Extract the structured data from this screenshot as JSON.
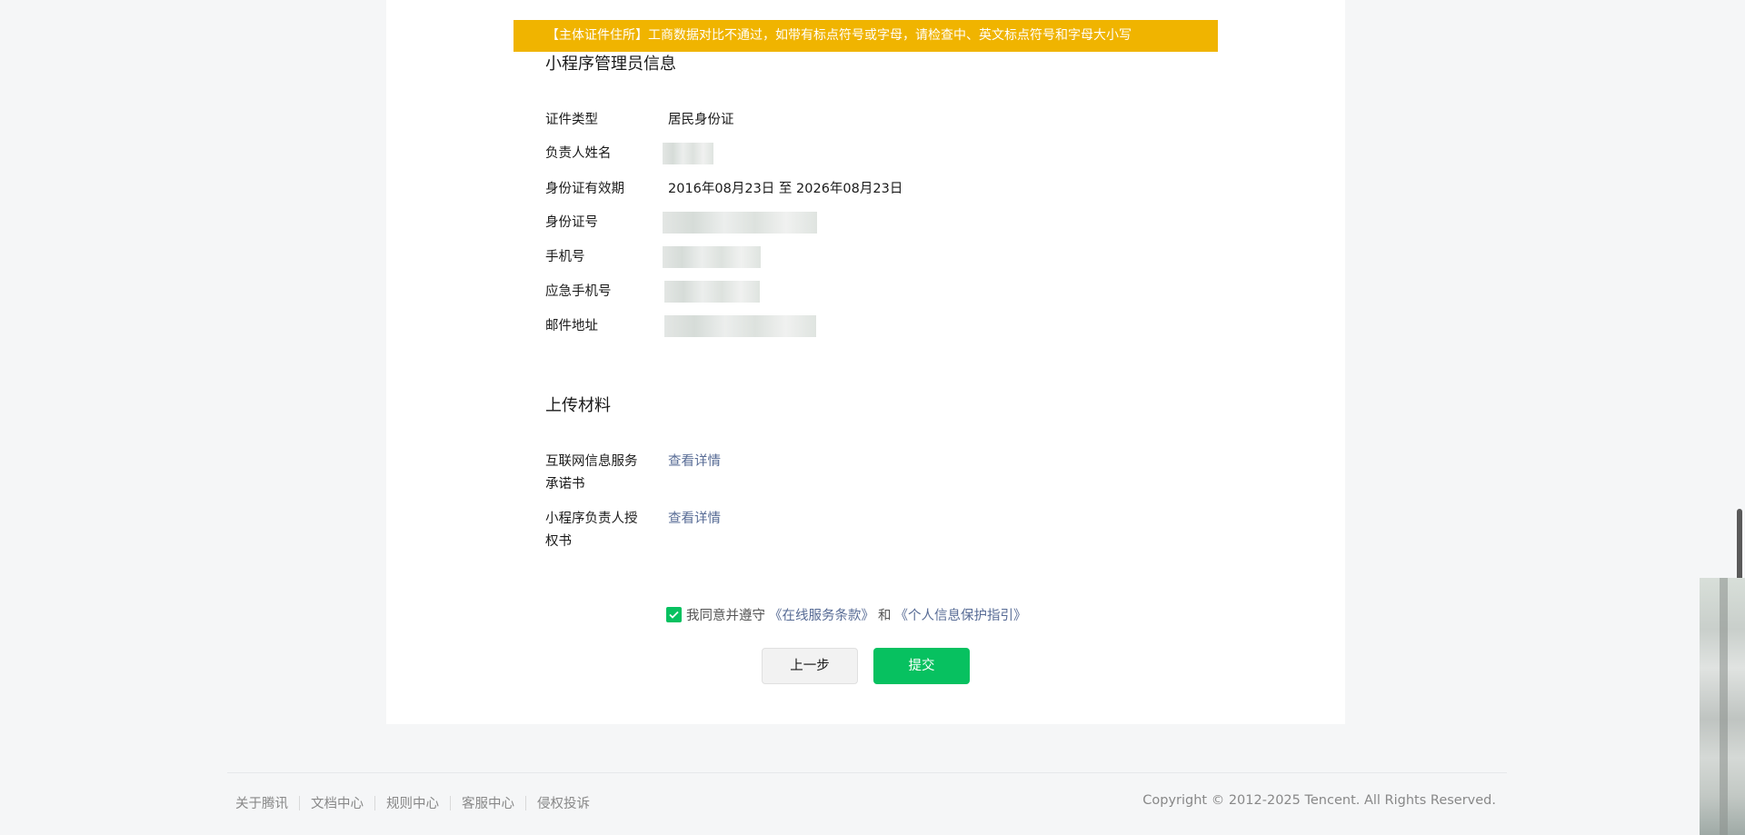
{
  "warning": {
    "text": "【主体证件住所】工商数据对比不通过，如带有标点符号或字母，请检查中、英文标点符号和字母大小写"
  },
  "admin_section": {
    "title": "小程序管理员信息",
    "rows": [
      {
        "label": "证件类型",
        "value": "居民身份证"
      },
      {
        "label": "负责人姓名",
        "value": ""
      },
      {
        "label": "身份证有效期",
        "value": "2016年08月23日 至 2026年08月23日"
      },
      {
        "label": "身份证号",
        "value": ""
      },
      {
        "label": "手机号",
        "value": ""
      },
      {
        "label": "应急手机号",
        "value": ""
      },
      {
        "label": "邮件地址",
        "value": ""
      }
    ]
  },
  "upload_section": {
    "title": "上传材料",
    "items": [
      {
        "label": "互联网信息服务承诺书",
        "link": "查看详情"
      },
      {
        "label": "小程序负责人授权书",
        "link": "查看详情"
      }
    ]
  },
  "agreement": {
    "checked": true,
    "prefix": "我同意并遵守",
    "terms_link": "《在线服务条款》",
    "and": "和",
    "privacy_link": "《个人信息保护指引》"
  },
  "buttons": {
    "prev": "上一步",
    "submit": "提交"
  },
  "footer": {
    "links": [
      "关于腾讯",
      "文档中心",
      "规则中心",
      "客服中心",
      "侵权投诉"
    ],
    "copyright": "Copyright © 2012-2025 Tencent. All Rights Reserved."
  },
  "colors": {
    "accent": "#07c160",
    "warning": "#f0b400",
    "link": "#576b95"
  }
}
